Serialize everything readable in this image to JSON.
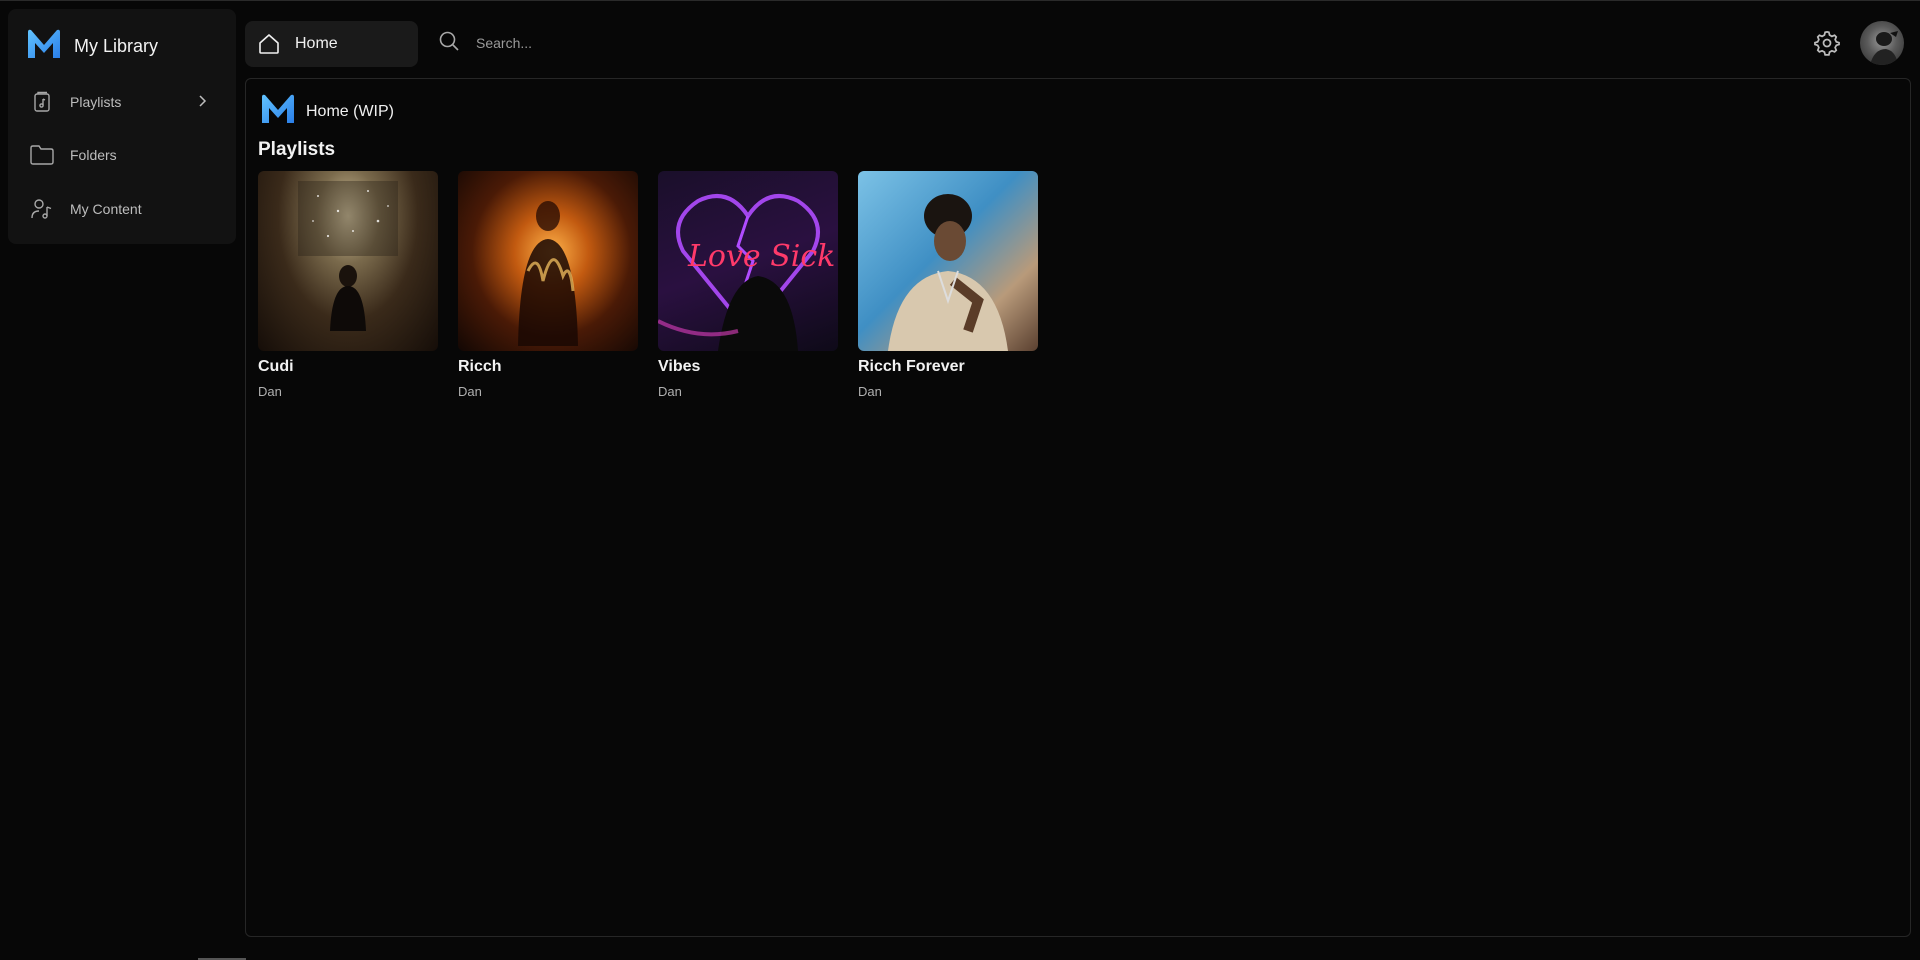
{
  "sidebar": {
    "title": "My Library",
    "items": [
      {
        "label": "Playlists",
        "icon": "music-file-icon",
        "has_chevron": true
      },
      {
        "label": "Folders",
        "icon": "folder-icon"
      },
      {
        "label": "My Content",
        "icon": "user-music-icon"
      }
    ]
  },
  "topbar": {
    "home_label": "Home",
    "search_placeholder": "Search..."
  },
  "main": {
    "title": "Home (WIP)",
    "section_title": "Playlists",
    "playlists": [
      {
        "title": "Cudi",
        "owner": "Dan"
      },
      {
        "title": "Ricch",
        "owner": "Dan"
      },
      {
        "title": "Vibes",
        "owner": "Dan",
        "cover_text": "Love Sick"
      },
      {
        "title": "Ricch Forever",
        "owner": "Dan"
      }
    ]
  },
  "colors": {
    "background": "#070707",
    "panel": "#121212",
    "accent": "#3aa0ff"
  }
}
